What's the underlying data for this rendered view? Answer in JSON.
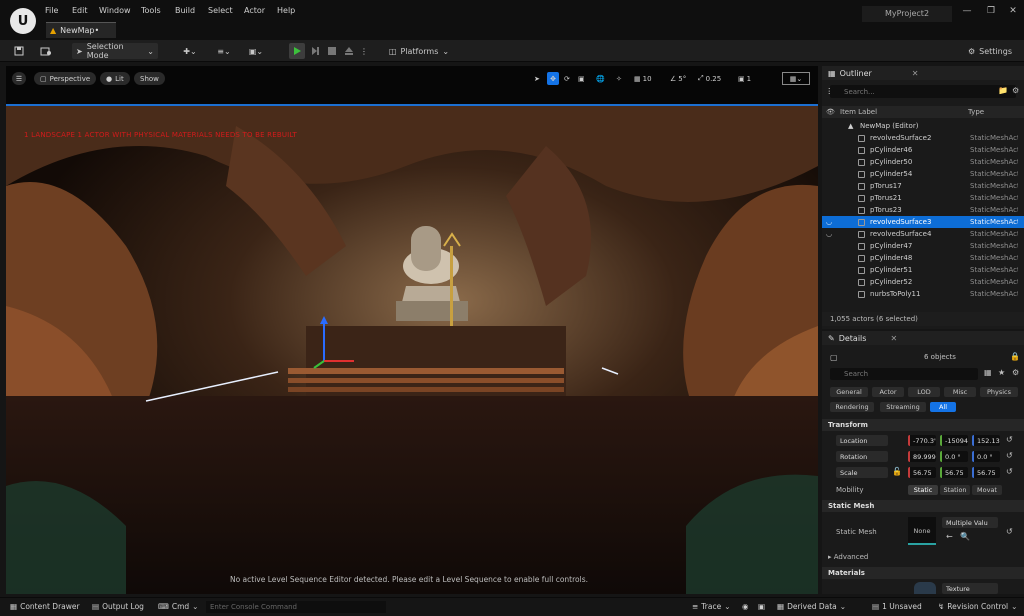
{
  "menu": [
    "File",
    "Edit",
    "Window",
    "Tools",
    "Build",
    "Select",
    "Actor",
    "Help"
  ],
  "tab_title": "NewMap•",
  "project_name": "MyProject2",
  "toolbar": {
    "selection_mode": "Selection Mode",
    "platforms": "Platforms",
    "settings": "Settings"
  },
  "viewport": {
    "perspective": "Perspective",
    "lit": "Lit",
    "show": "Show",
    "grid_snap": "10",
    "rot_snap": "5°",
    "scale_snap": "0.25",
    "cam_speed": "1",
    "warning": "1 LANDSCAPE 1 ACTOR WITH PHYSICAL MATERIALS NEEDS TO BE REBUILT",
    "sequence_msg": "No active Level Sequence Editor detected. Please edit a Level Sequence to enable full controls."
  },
  "outliner": {
    "title": "Outliner",
    "search_placeholder": "Search...",
    "col_label": "Item Label",
    "col_type": "Type",
    "root": "NewMap (Editor)",
    "rows": [
      {
        "name": "revolvedSurface2",
        "type": "StaticMeshActor"
      },
      {
        "name": "pCylinder46",
        "type": "StaticMeshActor"
      },
      {
        "name": "pCylinder50",
        "type": "StaticMeshActor"
      },
      {
        "name": "pCylinder54",
        "type": "StaticMeshActor"
      },
      {
        "name": "pTorus17",
        "type": "StaticMeshActor"
      },
      {
        "name": "pTorus21",
        "type": "StaticMeshActor"
      },
      {
        "name": "pTorus23",
        "type": "StaticMeshActor"
      },
      {
        "name": "revolvedSurface3",
        "type": "StaticMeshActor"
      },
      {
        "name": "revolvedSurface4",
        "type": "StaticMeshActor"
      },
      {
        "name": "pCylinder47",
        "type": "StaticMeshActor"
      },
      {
        "name": "pCylinder48",
        "type": "StaticMeshActor"
      },
      {
        "name": "pCylinder51",
        "type": "StaticMeshActor"
      },
      {
        "name": "pCylinder52",
        "type": "StaticMeshActor"
      },
      {
        "name": "nurbsToPoly11",
        "type": "StaticMeshActor"
      }
    ],
    "footer": "1,055 actors (6 selected)"
  },
  "details": {
    "title": "Details",
    "objects": "6 objects",
    "search_placeholder": "Search",
    "filters_row1": [
      "General",
      "Actor",
      "LOD",
      "Misc",
      "Physics"
    ],
    "filters_row2": [
      "Rendering",
      "Streaming",
      "All"
    ],
    "transform": "Transform",
    "location": "Location",
    "rotation": "Rotation",
    "scale": "Scale",
    "loc": [
      "-770.3'",
      "-15094",
      "152.13"
    ],
    "rot": [
      "89.999'",
      "0.0 °",
      "0.0 °"
    ],
    "scl": [
      "56.75",
      "56.75",
      "56.75"
    ],
    "mobility": "Mobility",
    "mobility_opts": [
      "Static",
      "Station",
      "Movat"
    ],
    "static_mesh_section": "Static Mesh",
    "static_mesh_label": "Static Mesh",
    "mesh_none": "None",
    "mesh_value": "Multiple Valu",
    "advanced": "Advanced",
    "materials": "Materials",
    "texture": "Texture"
  },
  "status": {
    "content_drawer": "Content Drawer",
    "output_log": "Output Log",
    "cmd": "Cmd",
    "console_placeholder": "Enter Console Command",
    "trace": "Trace",
    "derived_data": "Derived Data",
    "unsaved": "1 Unsaved",
    "revision": "Revision Control"
  }
}
